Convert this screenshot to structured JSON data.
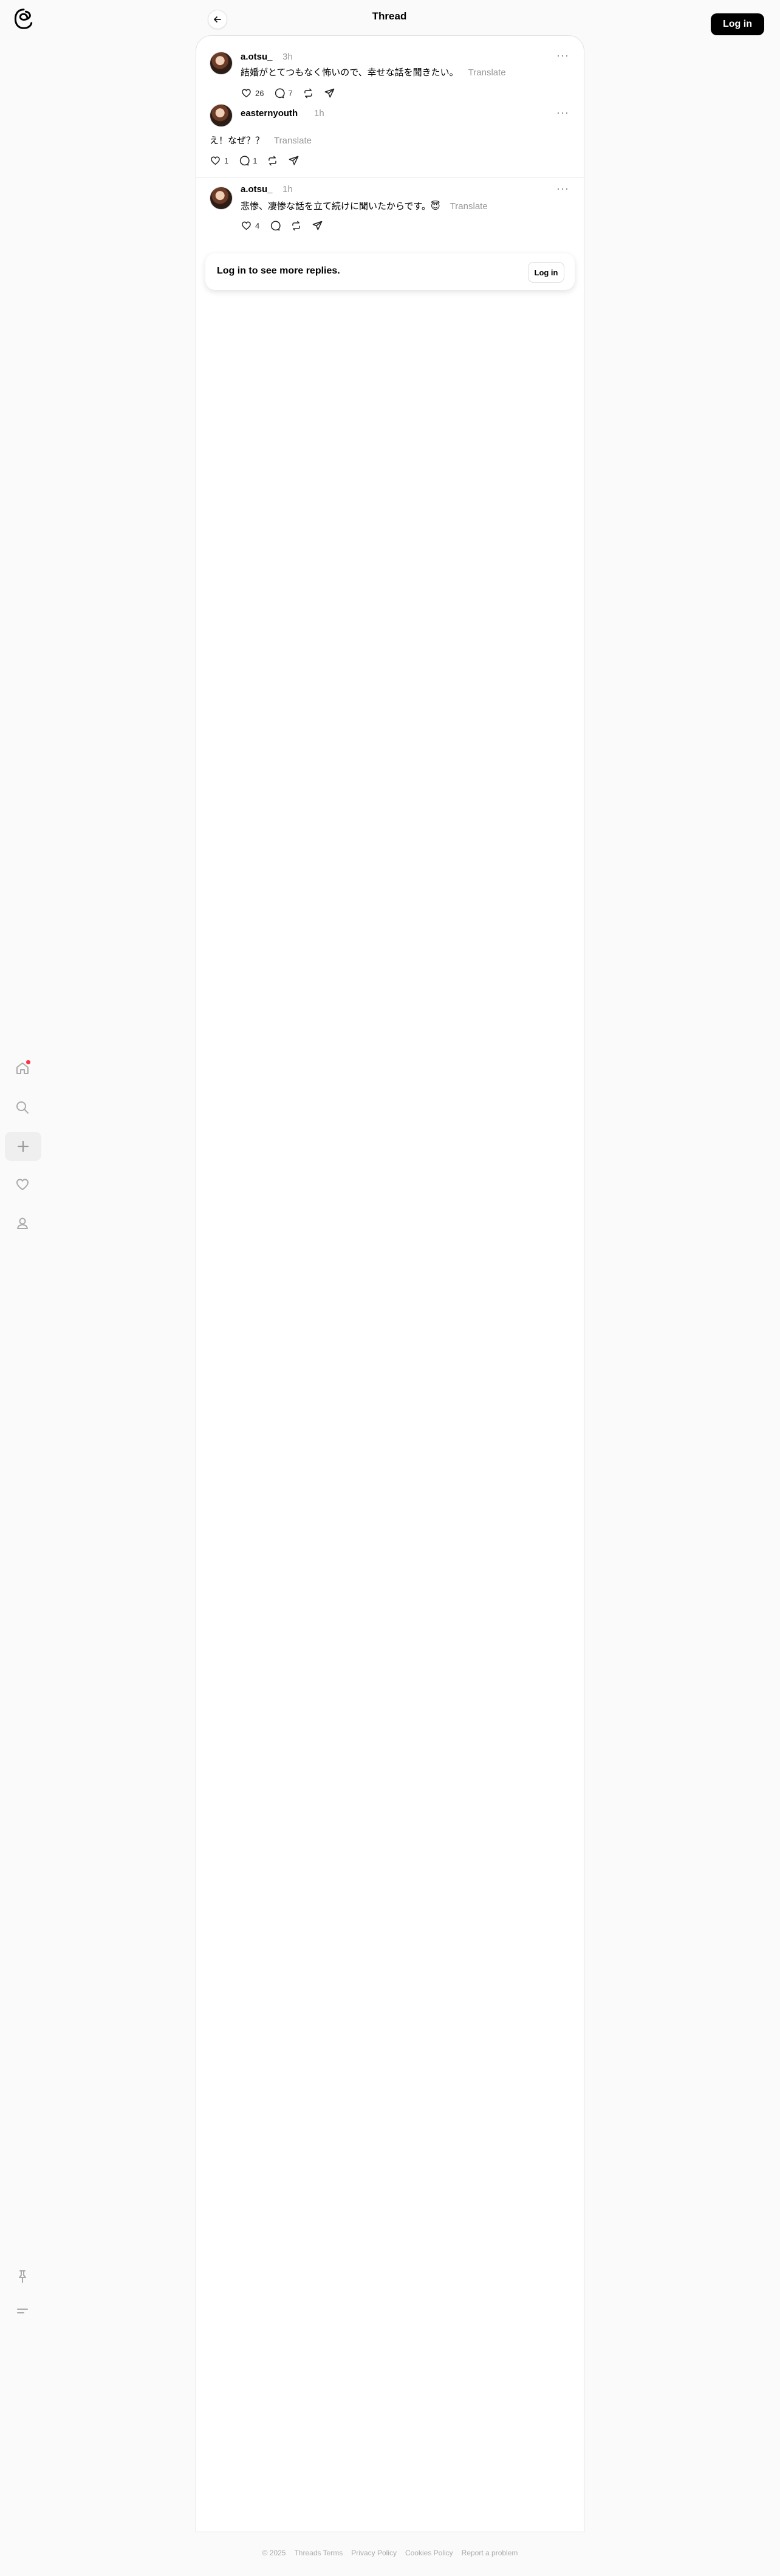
{
  "header": {
    "title": "Thread",
    "login_label": "Log in"
  },
  "icons": {
    "logo": "threads-logo-icon",
    "back": "arrow-left-icon",
    "nav": [
      "home-icon",
      "search-icon",
      "plus-icon",
      "heart-icon",
      "profile-icon"
    ],
    "bottom": [
      "pin-icon",
      "menu-icon"
    ]
  },
  "posts": [
    {
      "username": "a.otsu_",
      "time": "3h",
      "text": "結婚がとてつもなく怖いので、幸せな話を聞きたい。",
      "translate": "Translate",
      "likes": "26",
      "replies": "7"
    },
    {
      "username": "easternyouth",
      "time": "1h",
      "text": "え！なぜ？？",
      "translate": "Translate",
      "likes": "1",
      "replies": "1"
    },
    {
      "username": "a.otsu_",
      "time": "1h",
      "text": "悲惨、凄惨な話を立て続けに聞いたからです。😇",
      "translate": "Translate",
      "likes": "4",
      "replies": ""
    }
  ],
  "login_prompt": {
    "text": "Log in to see more replies.",
    "button": "Log in"
  },
  "footer": {
    "copyright": "© 2025",
    "links": [
      "Threads Terms",
      "Privacy Policy",
      "Cookies Policy",
      "Report a problem"
    ]
  },
  "colors": {
    "accent": "#000000",
    "notification": "#ff3040",
    "muted": "#999999"
  }
}
